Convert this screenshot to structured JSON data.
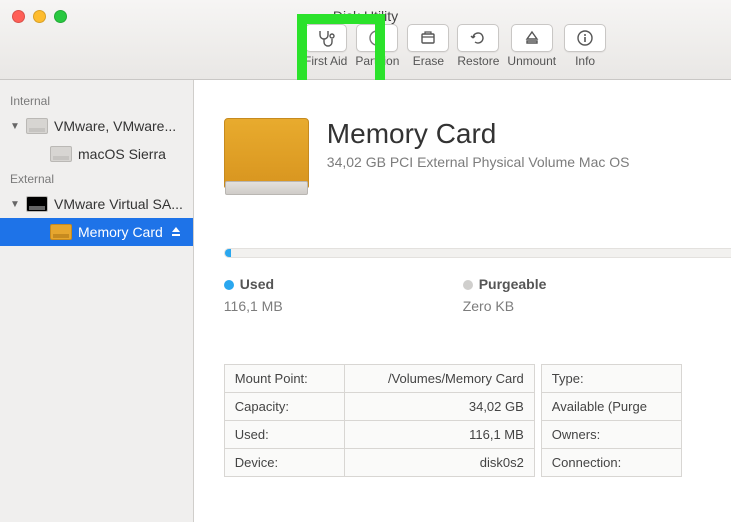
{
  "window": {
    "title": "Disk Utility"
  },
  "toolbar": {
    "first_aid": "First Aid",
    "partition": "Partition",
    "erase": "Erase",
    "restore": "Restore",
    "unmount": "Unmount",
    "info": "Info"
  },
  "sidebar": {
    "internal_label": "Internal",
    "external_label": "External",
    "internal": [
      {
        "label": "VMware, VMware..."
      },
      {
        "label": "macOS Sierra"
      }
    ],
    "external": [
      {
        "label": "VMware Virtual SA..."
      },
      {
        "label": "Memory Card"
      }
    ]
  },
  "volume": {
    "name": "Memory Card",
    "subtitle": "34,02 GB PCI External Physical Volume Mac OS"
  },
  "usage": {
    "used_label": "Used",
    "used_value": "116,1 MB",
    "purgeable_label": "Purgeable",
    "purgeable_value": "Zero KB",
    "used_pct": 1
  },
  "details": {
    "left": [
      {
        "k": "Mount Point:",
        "v": "/Volumes/Memory Card"
      },
      {
        "k": "Capacity:",
        "v": "34,02 GB"
      },
      {
        "k": "Used:",
        "v": "116,1 MB"
      },
      {
        "k": "Device:",
        "v": "disk0s2"
      }
    ],
    "right": [
      {
        "k": "Type:"
      },
      {
        "k": "Available (Purge"
      },
      {
        "k": "Owners:"
      },
      {
        "k": "Connection:"
      }
    ]
  }
}
